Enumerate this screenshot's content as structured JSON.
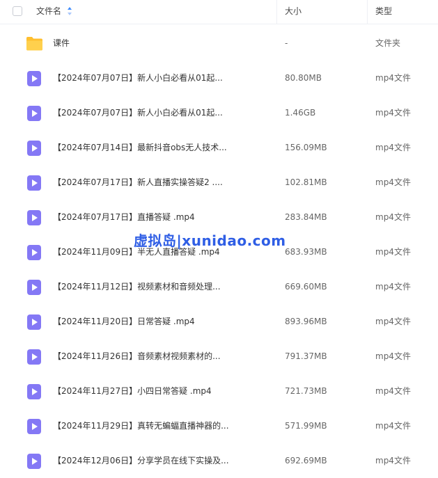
{
  "header": {
    "name_label": "文件名",
    "size_label": "大小",
    "type_label": "类型"
  },
  "folder": {
    "name": "课件",
    "size": "-",
    "type": "文件夹"
  },
  "files": [
    {
      "name": "【2024年07月07日】新人小白必看从01起...",
      "size": "80.80MB",
      "type": "mp4文件"
    },
    {
      "name": "【2024年07月07日】新人小白必看从01起...",
      "size": "1.46GB",
      "type": "mp4文件"
    },
    {
      "name": "【2024年07月14日】最新抖音obs无人技术...",
      "size": "156.09MB",
      "type": "mp4文件"
    },
    {
      "name": "【2024年07月17日】新人直播实操答疑2 ....",
      "size": "102.81MB",
      "type": "mp4文件"
    },
    {
      "name": "【2024年07月17日】直播答疑 .mp4",
      "size": "283.84MB",
      "type": "mp4文件"
    },
    {
      "name": "【2024年11月09日】半无人直播答疑 .mp4",
      "size": "683.93MB",
      "type": "mp4文件"
    },
    {
      "name": "【2024年11月12日】视频素材和音频处理...",
      "size": "669.60MB",
      "type": "mp4文件"
    },
    {
      "name": "【2024年11月20日】日常答疑 .mp4",
      "size": "893.96MB",
      "type": "mp4文件"
    },
    {
      "name": "【2024年11月26日】音频素材视频素材的...",
      "size": "791.37MB",
      "type": "mp4文件"
    },
    {
      "name": "【2024年11月27日】小四日常答疑 .mp4",
      "size": "721.73MB",
      "type": "mp4文件"
    },
    {
      "name": "【2024年11月29日】真转无蝙蝠直播神器的...",
      "size": "571.99MB",
      "type": "mp4文件"
    },
    {
      "name": "【2024年12月06日】分享学员在线下实操及...",
      "size": "692.69MB",
      "type": "mp4文件"
    }
  ],
  "watermark": "虚拟岛|xunidao.com",
  "icons": {
    "folder": "folder-icon",
    "video": "video-file-icon",
    "sort": "sort-icon"
  },
  "colors": {
    "folder": "#ffc73a",
    "video": "#7f72f2",
    "sort": "#3d8bfd",
    "watermark": "#2f5ee5"
  }
}
